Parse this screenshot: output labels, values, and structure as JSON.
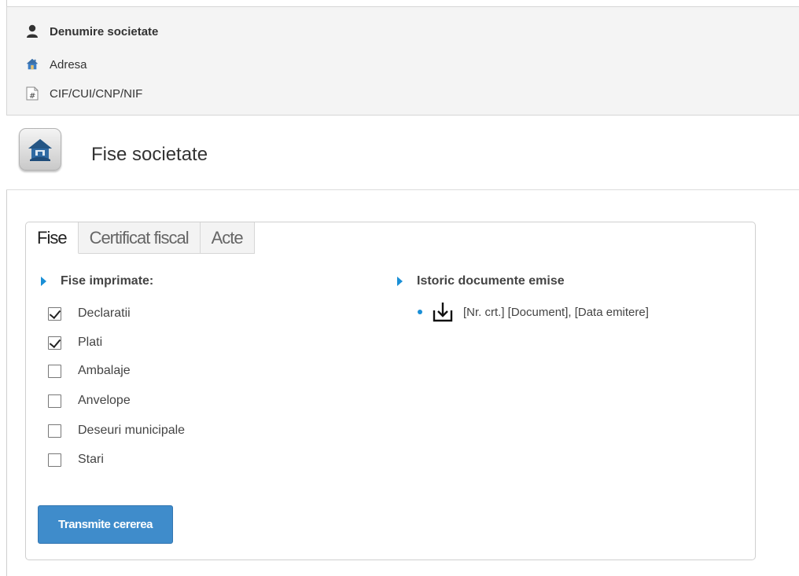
{
  "company": {
    "name_label": "Denumire societate",
    "address_label": "Adresa",
    "fiscal_id_label": "CIF/CUI/CNP/NIF",
    "icons": {
      "name": "user-icon",
      "address": "home-icon",
      "fiscal_id": "hash-document-icon"
    }
  },
  "page": {
    "title": "Fise societate",
    "icon": "company-house-icon"
  },
  "tabs": [
    {
      "label": "Fise",
      "active": true
    },
    {
      "label": "Certificat fiscal",
      "active": false
    },
    {
      "label": "Acte",
      "active": false
    }
  ],
  "printed_sheets": {
    "title": "Fise imprimate:",
    "options": [
      {
        "label": "Declaratii",
        "checked": true
      },
      {
        "label": "Plati",
        "checked": true
      },
      {
        "label": "Ambalaje",
        "checked": false
      },
      {
        "label": "Anvelope",
        "checked": false
      },
      {
        "label": "Deseuri municipale",
        "checked": false
      },
      {
        "label": "Stari",
        "checked": false
      }
    ]
  },
  "history": {
    "title": "Istoric documente emise",
    "items": [
      {
        "text": "[Nr. crt.] [Document], [Data emitere]",
        "icon": "download-icon"
      }
    ]
  },
  "actions": {
    "submit_label": "Transmite cererea"
  },
  "colors": {
    "accent": "#1a8fd6",
    "button": "#3f8ccb",
    "header_bg": "#f4f4f4"
  }
}
